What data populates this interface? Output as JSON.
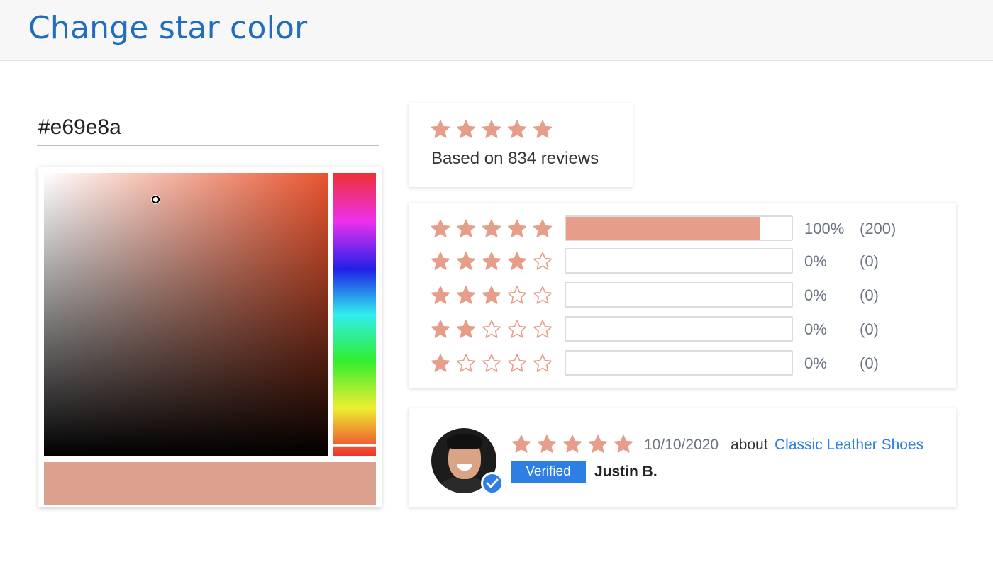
{
  "page": {
    "title": "Change star color"
  },
  "color_input": {
    "value": "#e69e8a"
  },
  "colors": {
    "star": "#e69e8a",
    "swatch": "#dca08e",
    "accent_blue": "#2d7fe3",
    "title_blue": "#1f6cc0"
  },
  "icons": {
    "star_filled": "star-filled-icon",
    "star_outline": "star-outline-icon",
    "check": "check-icon"
  },
  "summary": {
    "rating": 5,
    "based_on": "Based on 834 reviews"
  },
  "breakdown": [
    {
      "stars": 5,
      "fraction": 0.86,
      "percent": "100%",
      "count": "(200)"
    },
    {
      "stars": 4,
      "fraction": 0,
      "percent": "0%",
      "count": "(0)"
    },
    {
      "stars": 3,
      "fraction": 0,
      "percent": "0%",
      "count": "(0)"
    },
    {
      "stars": 2,
      "fraction": 0,
      "percent": "0%",
      "count": "(0)"
    },
    {
      "stars": 1,
      "fraction": 0,
      "percent": "0%",
      "count": "(0)"
    }
  ],
  "review": {
    "rating": 5,
    "date": "10/10/2020",
    "about": "about",
    "product": "Classic Leather Shoes",
    "badge": "Verified",
    "reviewer": "Justin B."
  }
}
